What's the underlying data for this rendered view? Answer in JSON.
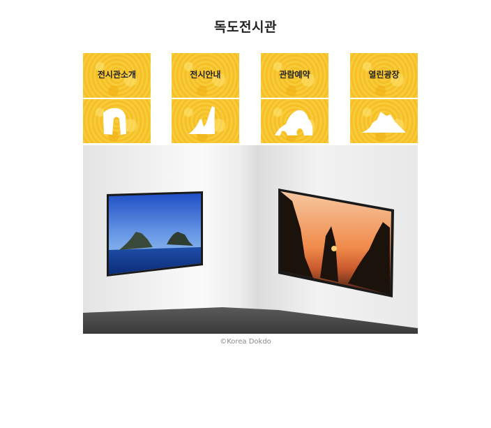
{
  "page": {
    "title": "독도전시관"
  },
  "menu": [
    {
      "label": "전시관소개",
      "icon": "dokdo-arch-rock-icon"
    },
    {
      "label": "전시안내",
      "icon": "dokdo-candle-rock-icon"
    },
    {
      "label": "관람예약",
      "icon": "dokdo-elephant-rock-icon"
    },
    {
      "label": "열린광장",
      "icon": "dokdo-island-icon"
    }
  ],
  "gallery": {
    "frames": [
      "dokdo-islands-daytime-photo",
      "dokdo-sunset-photo"
    ]
  },
  "credit": "©Korea Dokdo",
  "colors": {
    "menu_yellow": "#f7c52c",
    "frame_black": "#1a1a1a"
  }
}
